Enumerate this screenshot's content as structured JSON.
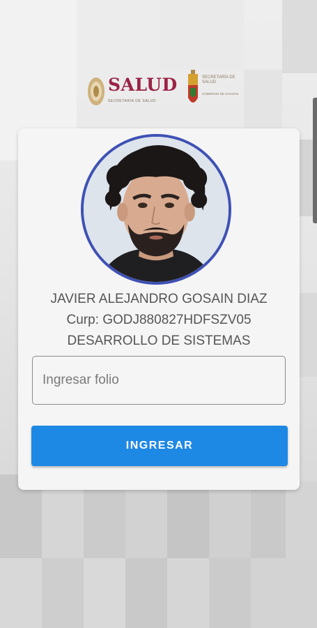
{
  "header": {
    "salud_logo_text": "SALUD",
    "salud_logo_subtext": "SECRETARÍA DE SALUD",
    "chiapas_logo_text": "SECRETARÍA DE SALUD",
    "chiapas_logo_subtext": "GOBIERNO DE CHIAPAS"
  },
  "profile": {
    "name": "JAVIER ALEJANDRO GOSAIN DIAZ",
    "curp": "Curp: GODJ880827HDFSZV05",
    "department": "DESARROLLO DE SISTEMAS"
  },
  "form": {
    "folio_placeholder": "Ingresar folio",
    "folio_value": "",
    "submit_label": "INGRESAR"
  },
  "colors": {
    "brand_primary": "#1e88e5",
    "avatar_border": "#3f51b5",
    "salud_accent": "#9b2346"
  }
}
